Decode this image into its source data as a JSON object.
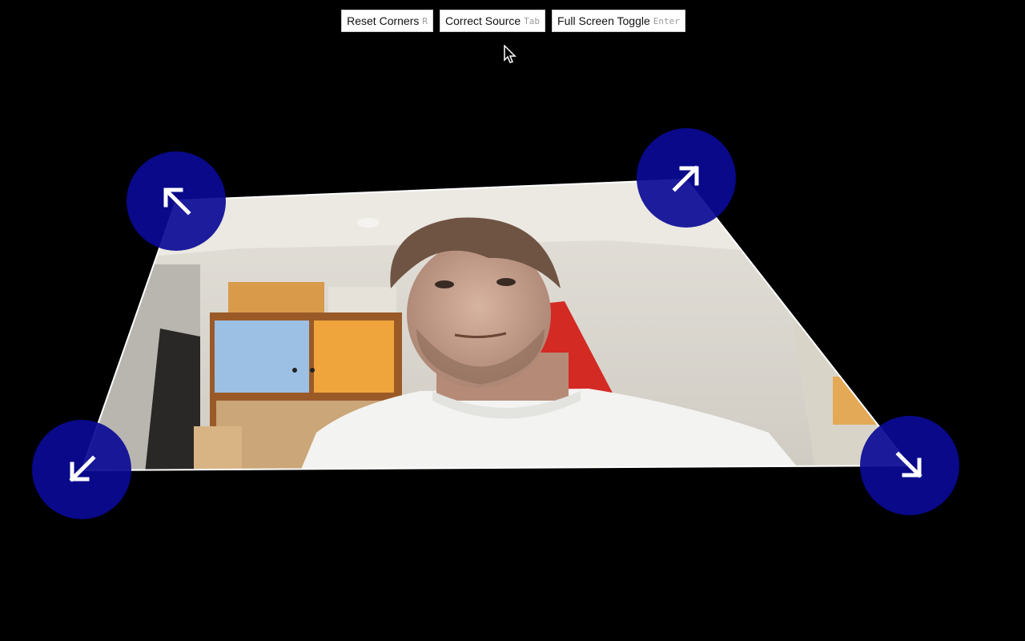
{
  "toolbar": {
    "buttons": [
      {
        "id": "reset",
        "label": "Reset Corners",
        "key": "R"
      },
      {
        "id": "source",
        "label": "Correct Source",
        "key": "Tab"
      },
      {
        "id": "fullscreen",
        "label": "Full Screen Toggle",
        "key": "Enter"
      }
    ]
  },
  "corner_handles": {
    "color": "#0a0a96",
    "arrow_color": "#ffffff",
    "top_left_icon": "arrow-up-left-icon",
    "top_right_icon": "arrow-up-right-icon",
    "bottom_left_icon": "arrow-down-left-icon",
    "bottom_right_icon": "arrow-down-right-icon"
  },
  "quad": {
    "outline_color": "#ffffff"
  },
  "cursor_icon": "mouse-pointer-icon"
}
